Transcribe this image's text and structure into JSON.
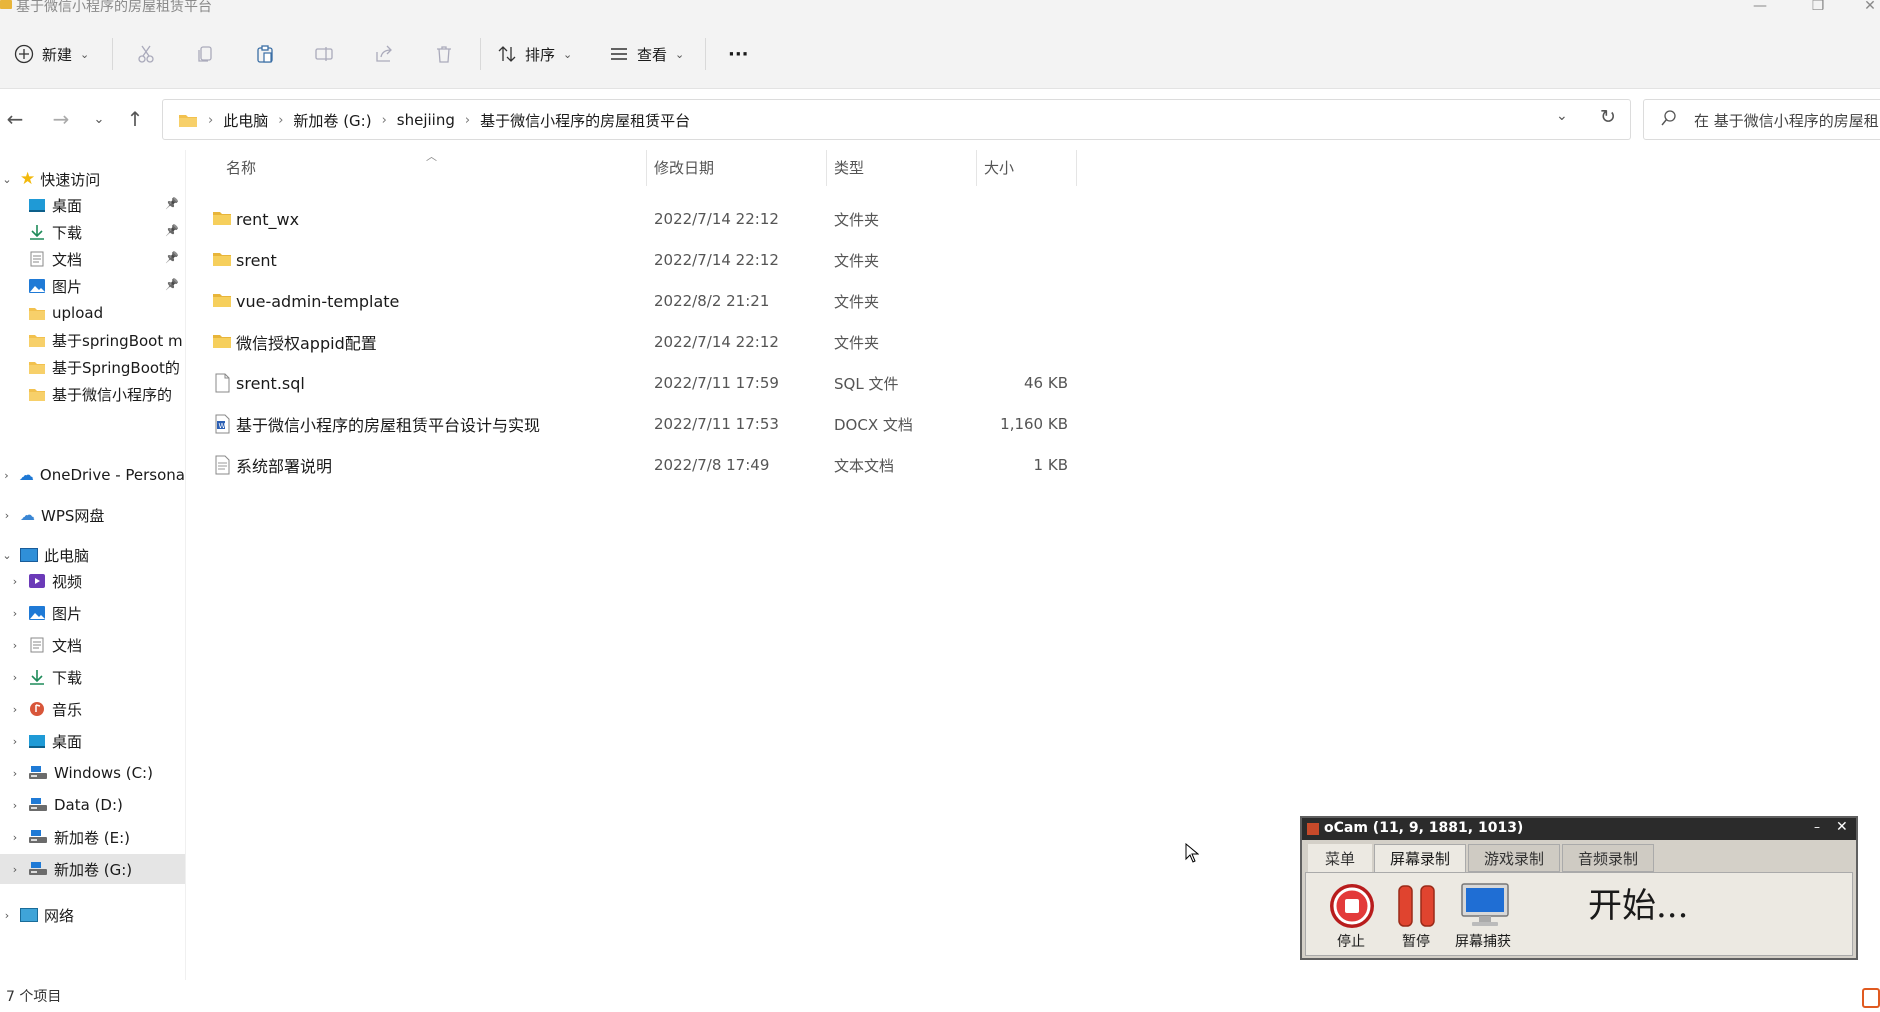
{
  "window": {
    "title": "基于微信小程序的房屋租赁平台",
    "controls": [
      "minimize-icon",
      "restore-icon",
      "close-icon"
    ]
  },
  "toolbar": {
    "new_label": "新建",
    "sort_label": "排序",
    "view_label": "查看",
    "more_label": "···",
    "icons": [
      "cut-icon",
      "copy-icon",
      "paste-icon",
      "rename-icon",
      "share-icon",
      "delete-icon"
    ]
  },
  "address": {
    "crumbs": [
      "此电脑",
      "新加卷 (G:)",
      "shejiing",
      "基于微信小程序的房屋租赁平台"
    ],
    "search_placeholder": "在 基于微信小程序的房屋租"
  },
  "nav": {
    "quick_access": "快速访问",
    "quick_items": [
      {
        "label": "桌面",
        "pinned": true,
        "icon": "desktop-icon"
      },
      {
        "label": "下载",
        "pinned": true,
        "icon": "download-icon"
      },
      {
        "label": "文档",
        "pinned": true,
        "icon": "document-icon"
      },
      {
        "label": "图片",
        "pinned": true,
        "icon": "pictures-icon"
      },
      {
        "label": "upload",
        "pinned": false,
        "icon": "folder-icon"
      },
      {
        "label": "基于springBoot m",
        "pinned": false,
        "icon": "folder-icon"
      },
      {
        "label": "基于SpringBoot的",
        "pinned": false,
        "icon": "folder-icon"
      },
      {
        "label": "基于微信小程序的",
        "pinned": false,
        "icon": "folder-icon"
      }
    ],
    "onedrive": "OneDrive - Persona",
    "wps": "WPS网盘",
    "this_pc": "此电脑",
    "pc_items": [
      {
        "label": "视频",
        "icon": "video-icon"
      },
      {
        "label": "图片",
        "icon": "pictures-icon"
      },
      {
        "label": "文档",
        "icon": "document-icon"
      },
      {
        "label": "下载",
        "icon": "download-icon"
      },
      {
        "label": "音乐",
        "icon": "music-icon"
      },
      {
        "label": "桌面",
        "icon": "desktop-icon"
      },
      {
        "label": "Windows (C:)",
        "icon": "drive-icon"
      },
      {
        "label": "Data (D:)",
        "icon": "drive-icon"
      },
      {
        "label": "新加卷 (E:)",
        "icon": "drive-icon"
      },
      {
        "label": "新加卷 (G:)",
        "icon": "drive-icon",
        "selected": true
      }
    ],
    "network": "网络"
  },
  "list": {
    "columns": {
      "name": "名称",
      "date": "修改日期",
      "type": "类型",
      "size": "大小"
    },
    "rows": [
      {
        "name": "rent_wx",
        "date": "2022/7/14 22:12",
        "type": "文件夹",
        "size": "",
        "icon": "folder-icon"
      },
      {
        "name": "srent",
        "date": "2022/7/14 22:12",
        "type": "文件夹",
        "size": "",
        "icon": "folder-icon"
      },
      {
        "name": "vue-admin-template",
        "date": "2022/8/2 21:21",
        "type": "文件夹",
        "size": "",
        "icon": "folder-icon"
      },
      {
        "name": "微信授权appid配置",
        "date": "2022/7/14 22:12",
        "type": "文件夹",
        "size": "",
        "icon": "folder-icon"
      },
      {
        "name": "srent.sql",
        "date": "2022/7/11 17:59",
        "type": "SQL 文件",
        "size": "46 KB",
        "icon": "file-icon"
      },
      {
        "name": "基于微信小程序的房屋租赁平台设计与实现",
        "date": "2022/7/11 17:53",
        "type": "DOCX 文档",
        "size": "1,160 KB",
        "icon": "word-doc-icon"
      },
      {
        "name": "系统部署说明",
        "date": "2022/7/8 17:49",
        "type": "文本文档",
        "size": "1 KB",
        "icon": "text-file-icon"
      }
    ]
  },
  "status": {
    "item_count": "7 个项目"
  },
  "ocam": {
    "title": "oCam (11, 9, 1881, 1013)",
    "tabs": [
      "菜单",
      "屏幕录制",
      "游戏录制",
      "音频录制"
    ],
    "active_tab": 1,
    "buttons": {
      "stop": "停止",
      "pause": "暂停",
      "capture": "屏幕捕获"
    },
    "status": "开始...",
    "colors": {
      "stop": "#d42a2a",
      "pause": "#e0442f",
      "titlebar": "#2b2b2b"
    }
  }
}
